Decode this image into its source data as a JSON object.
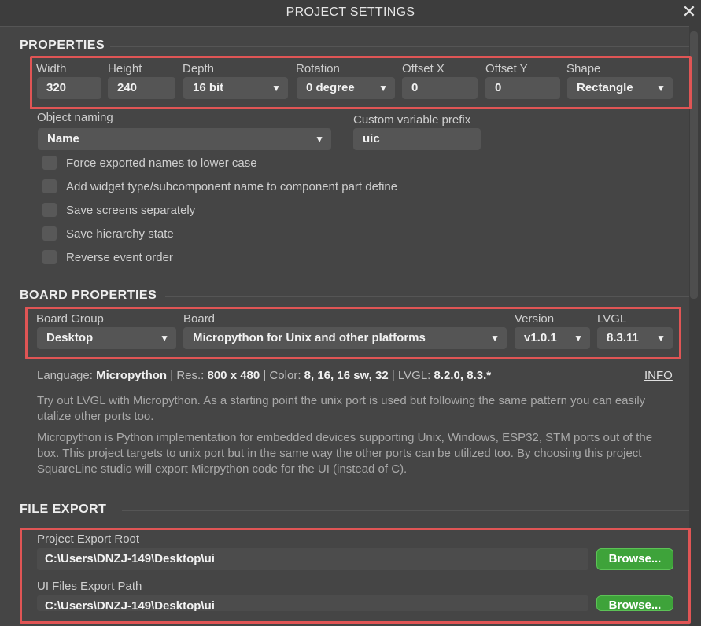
{
  "window": {
    "title": "PROJECT SETTINGS",
    "close_icon": "close-icon"
  },
  "properties": {
    "section_title": "PROPERTIES",
    "width": {
      "label": "Width",
      "value": "320"
    },
    "height": {
      "label": "Height",
      "value": "240"
    },
    "depth": {
      "label": "Depth",
      "value": "16 bit"
    },
    "rotation": {
      "label": "Rotation",
      "value": "0 degree"
    },
    "offset_x": {
      "label": "Offset X",
      "value": "0"
    },
    "offset_y": {
      "label": "Offset Y",
      "value": "0"
    },
    "shape": {
      "label": "Shape",
      "value": "Rectangle"
    },
    "object_naming": {
      "label": "Object naming",
      "value": "Name"
    },
    "custom_prefix": {
      "label": "Custom variable prefix",
      "value": "uic"
    },
    "checkboxes": [
      "Force exported names to lower case",
      "Add widget type/subcomponent name to component part define",
      "Save screens separately",
      "Save hierarchy state",
      "Reverse event order"
    ]
  },
  "board": {
    "section_title": "BOARD PROPERTIES",
    "group": {
      "label": "Board Group",
      "value": "Desktop"
    },
    "board": {
      "label": "Board",
      "value": "Micropython for Unix and other platforms"
    },
    "version": {
      "label": "Version",
      "value": "v1.0.1"
    },
    "lvgl": {
      "label": "LVGL",
      "value": "8.3.11"
    },
    "info": {
      "language_label": "Language:",
      "language": "Micropython",
      "res_label": "| Res.:",
      "res": "800 x 480",
      "color_label": "| Color:",
      "color": "8, 16, 16 sw, 32",
      "lvgl_label": "| LVGL:",
      "lvgl": "8.2.0, 8.3.*",
      "link": "INFO"
    },
    "desc1": "Try out LVGL with Micropython. As a starting point the unix port is used but following the same pattern you can easily utalize other ports too.",
    "desc2": "Micropython is Python implementation for embedded devices supporting Unix, Windows, ESP32, STM ports out of the box. This project targets to unix port but in the same way the other ports can be utilized too. By choosing this project SquareLine studio will export Micrpython code for the UI (instead of C)."
  },
  "file_export": {
    "section_title": "FILE EXPORT",
    "project_root": {
      "label": "Project Export Root",
      "value": "C:\\Users\\DNZJ-149\\Desktop\\ui",
      "button": "Browse..."
    },
    "ui_files": {
      "label": "UI Files Export Path",
      "value": "C:\\Users\\DNZJ-149\\Desktop\\ui",
      "button": "Browse..."
    }
  },
  "colors": {
    "background": "#454545",
    "field": "#555555",
    "highlight": "#e05555",
    "browse_button": "#3ea33a"
  }
}
